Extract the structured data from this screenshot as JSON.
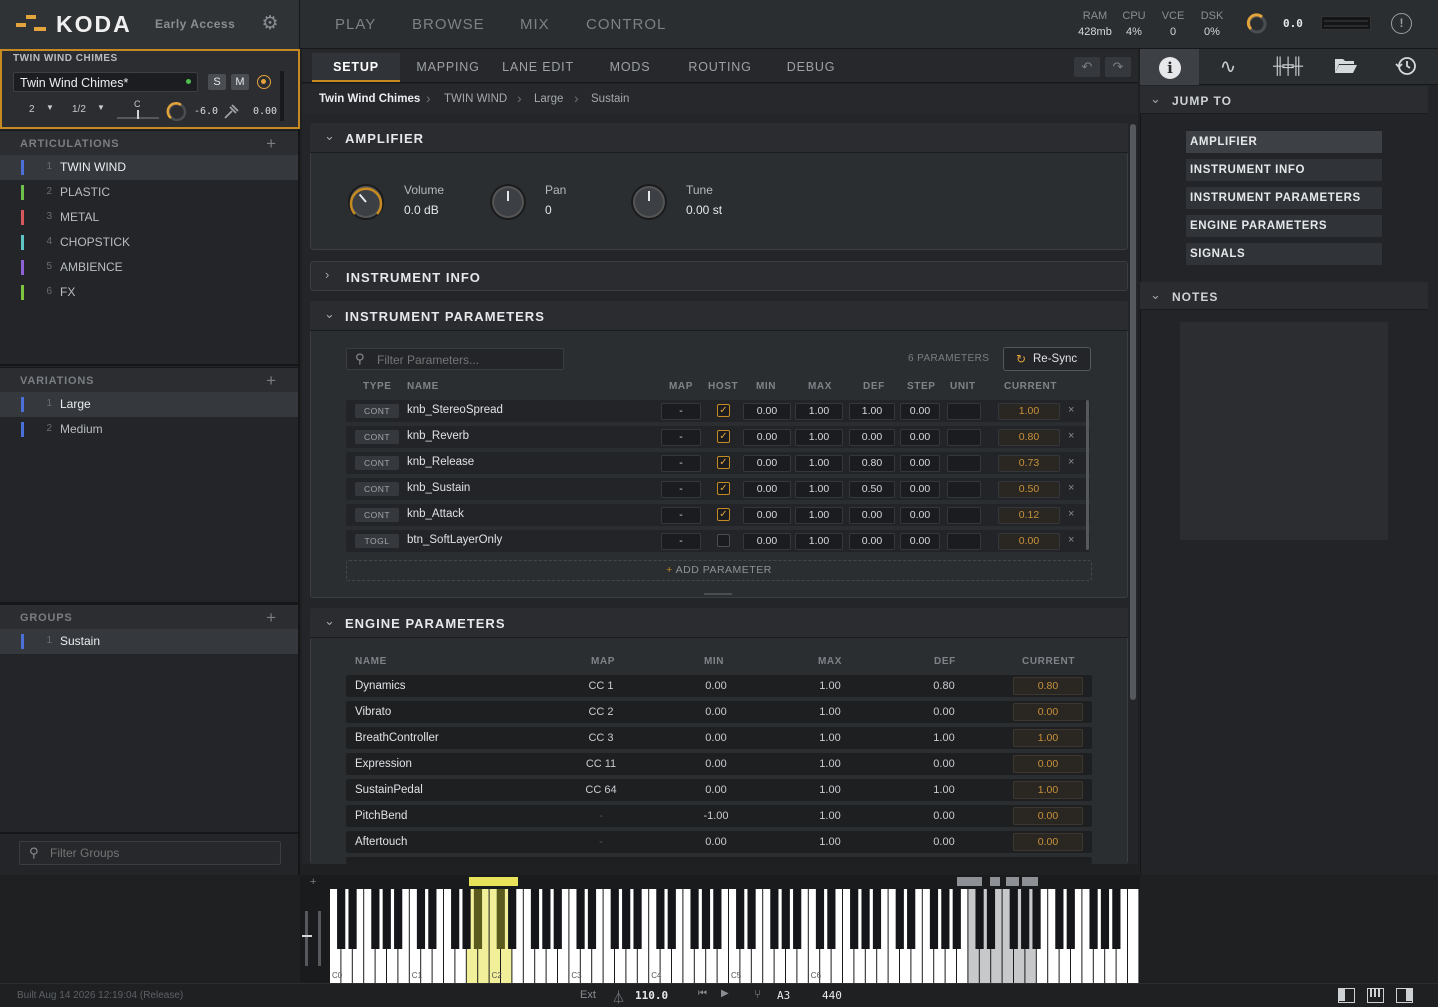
{
  "app": {
    "name": "KODA",
    "badge": "Early Access"
  },
  "topnav": [
    "PLAY",
    "BROWSE",
    "MIX",
    "CONTROL"
  ],
  "stats": [
    {
      "label": "RAM",
      "value": "428mb"
    },
    {
      "label": "CPU",
      "value": "4%"
    },
    {
      "label": "VCE",
      "value": "0"
    },
    {
      "label": "DSK",
      "value": "0%"
    }
  ],
  "master_value": "0.0",
  "instrument": {
    "header": "TWIN WIND CHIMES",
    "name": "Twin Wind Chimes*",
    "solo": "S",
    "mute": "M",
    "channel": "2",
    "division": "1/2",
    "pan_label": "C",
    "volume": "-6.0",
    "tune": "0.00"
  },
  "articulations": {
    "title": "ARTICULATIONS",
    "add": "+",
    "items": [
      {
        "num": "1",
        "label": "TWIN WIND",
        "color": "#4a6fd6",
        "selected": true
      },
      {
        "num": "2",
        "label": "PLASTIC",
        "color": "#6ec04a"
      },
      {
        "num": "3",
        "label": "METAL",
        "color": "#d6585b"
      },
      {
        "num": "4",
        "label": "CHOPSTICK",
        "color": "#5fc6c6"
      },
      {
        "num": "5",
        "label": "AMBIENCE",
        "color": "#8d62d6"
      },
      {
        "num": "6",
        "label": "FX",
        "color": "#7ec43e"
      }
    ]
  },
  "variations": {
    "title": "VARIATIONS",
    "add": "+",
    "items": [
      {
        "num": "1",
        "label": "Large",
        "color": "#4a6fd6",
        "selected": true
      },
      {
        "num": "2",
        "label": "Medium",
        "color": "#4a6fd6"
      }
    ]
  },
  "groups": {
    "title": "GROUPS",
    "add": "+",
    "items": [
      {
        "num": "1",
        "label": "Sustain",
        "color": "#4a6fd6",
        "selected": true
      }
    ],
    "filter_placeholder": "Filter Groups"
  },
  "tabs": [
    "SETUP",
    "MAPPING",
    "LANE EDIT",
    "MODS",
    "ROUTING",
    "DEBUG"
  ],
  "breadcrumb": [
    "Twin Wind Chimes",
    "TWIN WIND",
    "Large",
    "Sustain"
  ],
  "amplifier": {
    "title": "AMPLIFIER",
    "knobs": [
      {
        "label": "Volume",
        "value": "0.0 dB"
      },
      {
        "label": "Pan",
        "value": "0"
      },
      {
        "label": "Tune",
        "value": "0.00 st"
      }
    ]
  },
  "instrument_info": {
    "title": "INSTRUMENT INFO"
  },
  "instrument_parameters": {
    "title": "INSTRUMENT PARAMETERS",
    "filter_placeholder": "Filter Parameters...",
    "count": "6 PARAMETERS",
    "resync": "Re-Sync",
    "columns": [
      "TYPE",
      "NAME",
      "MAP",
      "HOST",
      "MIN",
      "MAX",
      "DEF",
      "STEP",
      "UNIT",
      "CURRENT"
    ],
    "rows": [
      {
        "type": "CONT",
        "name": "knb_StereoSpread",
        "map": "-",
        "host": true,
        "min": "0.00",
        "max": "1.00",
        "def": "1.00",
        "step": "0.00",
        "current": "1.00"
      },
      {
        "type": "CONT",
        "name": "knb_Reverb",
        "map": "-",
        "host": true,
        "min": "0.00",
        "max": "1.00",
        "def": "0.00",
        "step": "0.00",
        "current": "0.80"
      },
      {
        "type": "CONT",
        "name": "knb_Release",
        "map": "-",
        "host": true,
        "min": "0.00",
        "max": "1.00",
        "def": "0.80",
        "step": "0.00",
        "current": "0.73"
      },
      {
        "type": "CONT",
        "name": "knb_Sustain",
        "map": "-",
        "host": true,
        "min": "0.00",
        "max": "1.00",
        "def": "0.50",
        "step": "0.00",
        "current": "0.50"
      },
      {
        "type": "CONT",
        "name": "knb_Attack",
        "map": "-",
        "host": true,
        "min": "0.00",
        "max": "1.00",
        "def": "0.00",
        "step": "0.00",
        "current": "0.12"
      },
      {
        "type": "TOGL",
        "name": "btn_SoftLayerOnly",
        "map": "-",
        "host": false,
        "min": "0.00",
        "max": "1.00",
        "def": "0.00",
        "step": "0.00",
        "current": "0.00"
      }
    ],
    "add": "ADD PARAMETER",
    "remove": "×"
  },
  "engine_parameters": {
    "title": "ENGINE PARAMETERS",
    "columns": [
      "NAME",
      "MAP",
      "MIN",
      "MAX",
      "DEF",
      "CURRENT"
    ],
    "rows": [
      {
        "name": "Dynamics",
        "map": "CC 1",
        "min": "0.00",
        "max": "1.00",
        "def": "0.80",
        "current": "0.80"
      },
      {
        "name": "Vibrato",
        "map": "CC 2",
        "min": "0.00",
        "max": "1.00",
        "def": "0.00",
        "current": "0.00"
      },
      {
        "name": "BreathController",
        "map": "CC 3",
        "min": "0.00",
        "max": "1.00",
        "def": "1.00",
        "current": "1.00"
      },
      {
        "name": "Expression",
        "map": "CC 11",
        "min": "0.00",
        "max": "1.00",
        "def": "0.00",
        "current": "0.00"
      },
      {
        "name": "SustainPedal",
        "map": "CC 64",
        "min": "0.00",
        "max": "1.00",
        "def": "1.00",
        "current": "1.00"
      },
      {
        "name": "PitchBend",
        "map": "-",
        "min": "-1.00",
        "max": "1.00",
        "def": "0.00",
        "current": "0.00"
      },
      {
        "name": "Aftertouch",
        "map": "-",
        "min": "0.00",
        "max": "1.00",
        "def": "0.00",
        "current": "0.00"
      }
    ]
  },
  "jump_to": {
    "title": "JUMP TO",
    "items": [
      "AMPLIFIER",
      "INSTRUMENT INFO",
      "INSTRUMENT PARAMETERS",
      "ENGINE PARAMETERS",
      "SIGNALS"
    ]
  },
  "notes": {
    "title": "NOTES"
  },
  "piano": {
    "octaves": [
      "C0",
      "C1",
      "C2",
      "C3",
      "C4",
      "C5",
      "C6"
    ],
    "add": "+"
  },
  "status": {
    "build": "Built Aug 14 2026 12:19:04 (Release)",
    "sync": "Ext",
    "tempo": "110.0",
    "key": "A3",
    "tuning": "440"
  },
  "colors": {
    "accent": "#c58a22",
    "highlight": "#e8e35a"
  }
}
